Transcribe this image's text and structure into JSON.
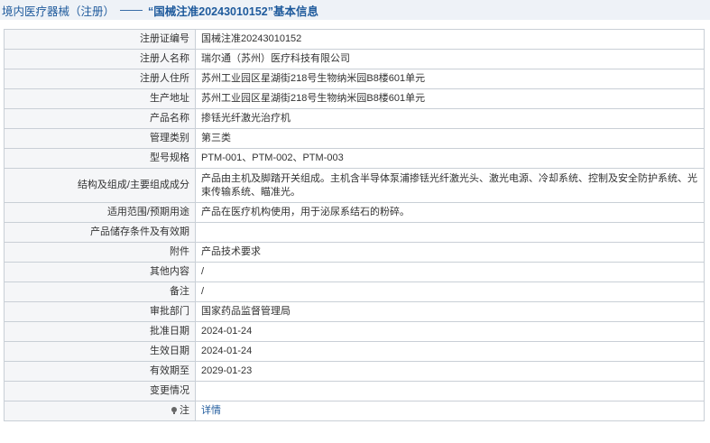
{
  "header": {
    "category": "境内医疗器械（注册）",
    "separator": "——",
    "title": "“国械注准20243010152”基本信息"
  },
  "rows": [
    {
      "label": "注册证编号",
      "value": "国械注准20243010152"
    },
    {
      "label": "注册人名称",
      "value": "瑞尔通（苏州）医疗科技有限公司"
    },
    {
      "label": "注册人住所",
      "value": "苏州工业园区星湖街218号生物纳米园B8楼601单元"
    },
    {
      "label": "生产地址",
      "value": "苏州工业园区星湖街218号生物纳米园B8楼601单元"
    },
    {
      "label": "产品名称",
      "value": "掺铥光纤激光治疗机"
    },
    {
      "label": "管理类别",
      "value": "第三类"
    },
    {
      "label": "型号规格",
      "value": "PTM-001、PTM-002、PTM-003"
    },
    {
      "label": "结构及组成/主要组成成分",
      "value": "产品由主机及脚踏开关组成。主机含半导体泵浦掺铥光纤激光头、激光电源、冷却系统、控制及安全防护系统、光束传输系统、瞄准光。"
    },
    {
      "label": "适用范围/预期用途",
      "value": "产品在医疗机构使用，用于泌尿系结石的粉碎。"
    },
    {
      "label": "产品储存条件及有效期",
      "value": ""
    },
    {
      "label": "附件",
      "value": "产品技术要求"
    },
    {
      "label": "其他内容",
      "value": "/"
    },
    {
      "label": "备注",
      "value": "/"
    },
    {
      "label": "审批部门",
      "value": "国家药品监督管理局"
    },
    {
      "label": "批准日期",
      "value": "2024-01-24"
    },
    {
      "label": "生效日期",
      "value": "2024-01-24"
    },
    {
      "label": "有效期至",
      "value": "2029-01-23"
    },
    {
      "label": "变更情况",
      "value": ""
    }
  ],
  "note": {
    "label": "注",
    "link_text": "详情"
  }
}
